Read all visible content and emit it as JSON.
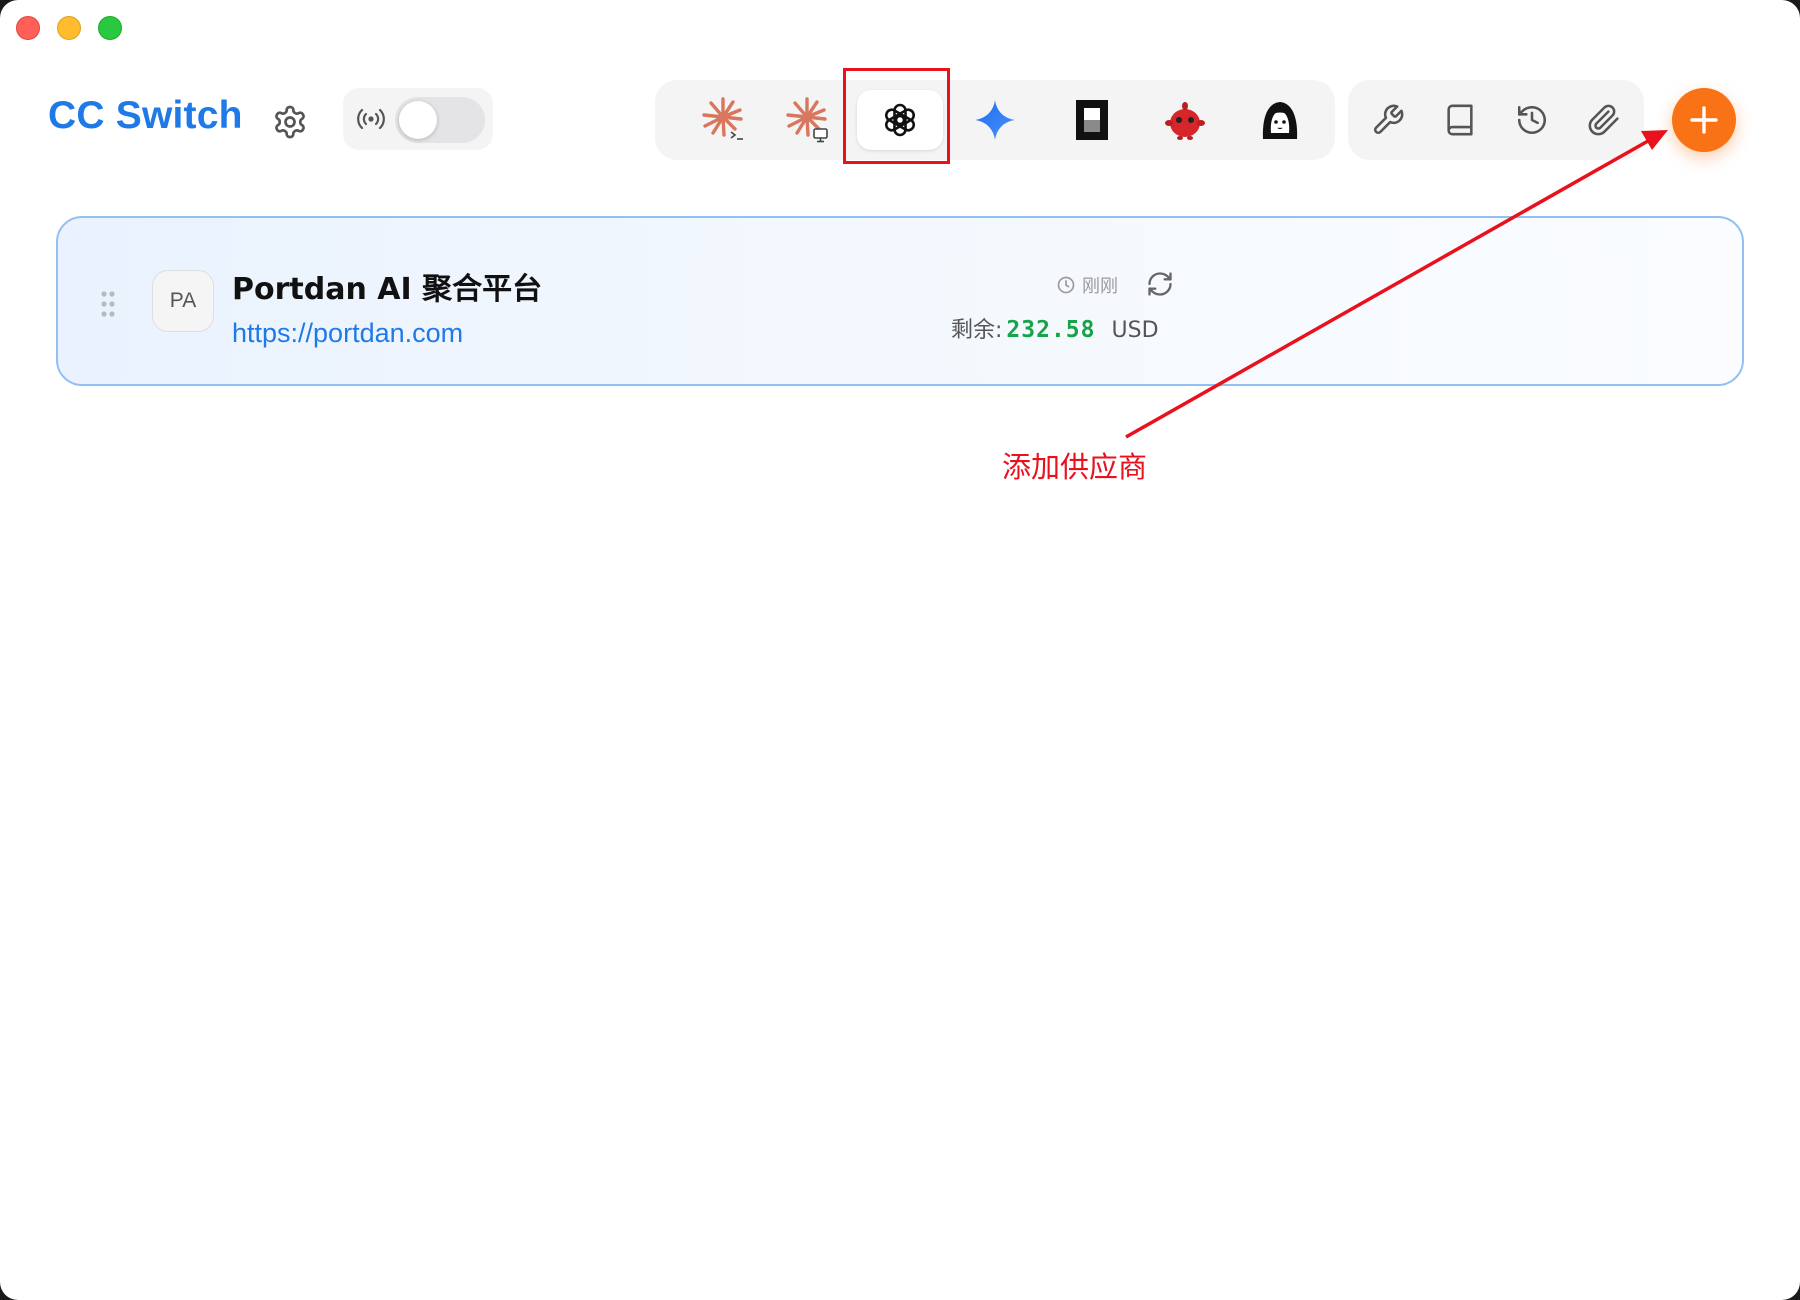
{
  "window": {
    "title": "CC Switch",
    "controls": [
      "close",
      "minimize",
      "maximize"
    ]
  },
  "header": {
    "app_title": "CC Switch",
    "settings_icon": "gear-icon",
    "proxy_toggle": {
      "icon": "broadcast-icon",
      "enabled": false
    }
  },
  "app_tabs": [
    {
      "icon": "claude-code-terminal-icon",
      "active": false
    },
    {
      "icon": "claude-desktop-icon",
      "active": false
    },
    {
      "icon": "openai-icon",
      "active": true
    },
    {
      "icon": "gemini-sparkle-icon",
      "active": false
    },
    {
      "icon": "opencode-icon",
      "active": false
    },
    {
      "icon": "red-mascot-icon",
      "active": false
    },
    {
      "icon": "anime-avatar-icon",
      "active": false
    }
  ],
  "tools": [
    {
      "icon": "wrench-icon"
    },
    {
      "icon": "book-icon"
    },
    {
      "icon": "history-icon"
    },
    {
      "icon": "paperclip-icon"
    }
  ],
  "add_button": {
    "icon": "plus-icon"
  },
  "providers": [
    {
      "avatar": "PA",
      "name": "Portdan AI 聚合平台",
      "url": "https://portdan.com",
      "updated": "刚刚",
      "balance_label": "剩余:",
      "balance_amount": "232.58",
      "balance_currency": "USD"
    }
  ],
  "annotation": {
    "text": "添加供应商",
    "color": "#e8111c"
  },
  "colors": {
    "accent": "#1f7ae8",
    "add_button": "#f97316",
    "balance": "#16a34a",
    "highlight": "#e8111c"
  }
}
